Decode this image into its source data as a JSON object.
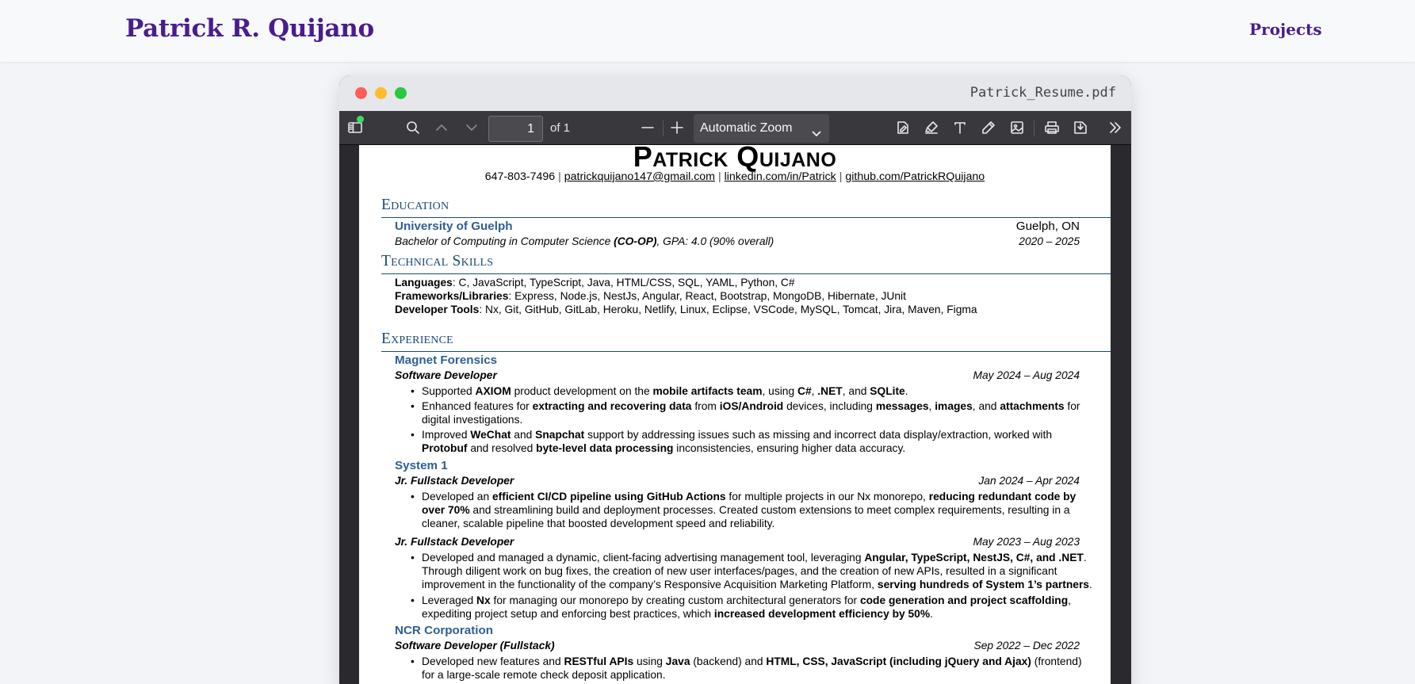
{
  "site": {
    "name": "Patrick R. Quijano",
    "nav_projects": "Projects"
  },
  "window": {
    "filename": "Patrick_Resume.pdf"
  },
  "toolbar": {
    "page_value": "1",
    "page_of": "of 1",
    "zoom": "Automatic Zoom",
    "icons": [
      "sidebar-toggle-icon",
      "search-icon",
      "chevron-up-icon",
      "chevron-down-icon",
      "zoom-out-icon",
      "zoom-in-icon",
      "signature-icon",
      "highlight-icon",
      "text-icon",
      "draw-icon",
      "image-icon",
      "print-icon",
      "save-icon",
      "double-chevron-right-icon"
    ]
  },
  "resume": {
    "name": "Patrick Quijano",
    "contact": {
      "phone": "647-803-7496",
      "email": "patrickquijano147@gmail.com",
      "linkedin": "linkedin.com/in/Patrick",
      "github": "github.com/PatrickRQuijano",
      "sep": "|"
    },
    "education": {
      "title": "Education",
      "school": "University of Guelph",
      "location": "Guelph, ON",
      "degree_pre": "Bachelor of Computing in Computer Science ",
      "degree_coop": "(CO-OP)",
      "degree_post": ", GPA: 4.0 (90% overall)",
      "dates": "2020 – 2025"
    },
    "skills": {
      "title": "Technical Skills",
      "languages_label": "Languages",
      "languages": ": C, JavaScript, TypeScript, Java, HTML/CSS, SQL, YAML, Python, C#",
      "frameworks_label": "Frameworks/Libraries",
      "frameworks": ": Express, Node.js, NestJs, Angular, React, Bootstrap, MongoDB, Hibernate, JUnit",
      "tools_label": "Developer Tools",
      "tools": ": Nx, Git, GitHub, GitLab, Heroku, Netlify, Linux, Eclipse, VSCode, MySQL, Tomcat, Jira, Maven, Figma"
    },
    "experience": {
      "title": "Experience",
      "magnet": {
        "org": "Magnet Forensics",
        "role": "Software Developer",
        "dates": "May 2024 – Aug 2024",
        "b1": [
          "Supported ",
          "AXIOM",
          " product development on the ",
          "mobile artifacts team",
          ", using ",
          "C#",
          ", ",
          ".NET",
          ", and ",
          "SQLite",
          "."
        ],
        "b2": [
          "Enhanced features for ",
          "extracting and recovering data",
          " from ",
          "iOS/Android",
          " devices, including ",
          "messages",
          ", ",
          "images",
          ", and ",
          "attachments",
          " for digital investigations."
        ],
        "b3": [
          "Improved ",
          "WeChat",
          " and ",
          "Snapchat",
          " support by addressing issues such as missing and incorrect data display/extraction, worked with ",
          "Protobuf",
          " and resolved ",
          "byte-level data processing",
          " inconsistencies, ensuring higher data accuracy."
        ]
      },
      "system1": {
        "org": "System 1",
        "role1": "Jr. Fullstack Developer",
        "dates1": "Jan 2024 – Apr 2024",
        "b1": [
          "Developed an ",
          "efficient CI/CD pipeline using GitHub Actions",
          " for multiple projects in our Nx monorepo, ",
          "reducing redundant code by over 70%",
          " and streamlining build and deployment processes. Created custom extensions to meet complex requirements, resulting in a cleaner, scalable pipeline that boosted development speed and reliability."
        ],
        "role2": "Jr. Fullstack Developer",
        "dates2": "May 2023 – Aug 2023",
        "b2": [
          "Developed and managed a dynamic, client-facing advertising management tool, leveraging ",
          "Angular, TypeScript, NestJS, C#, and .NET",
          ". Through diligent work on bug fixes, the creation of new user interfaces/pages, and the creation of new APIs, resulted in a significant improvement in the functionality of the company’s Responsive Acquisition Marketing Platform, ",
          "serving hundreds of System 1’s partners",
          "."
        ],
        "b3": [
          "Leveraged ",
          "Nx",
          " for managing our monorepo by creating custom architectural generators for ",
          "code generation and project scaffolding",
          ", expediting project setup and enforcing best practices, which ",
          "increased development efficiency by 50%",
          "."
        ]
      },
      "ncr": {
        "org": "NCR Corporation",
        "role": "Software Developer (Fullstack)",
        "dates": "Sep 2022 – Dec 2022",
        "b1": [
          "Developed new features and ",
          "RESTful APIs",
          " using ",
          "Java",
          " (backend) and ",
          "HTML, CSS, JavaScript (including jQuery and Ajax)",
          " (frontend) for a large-scale remote check deposit application."
        ]
      }
    }
  }
}
